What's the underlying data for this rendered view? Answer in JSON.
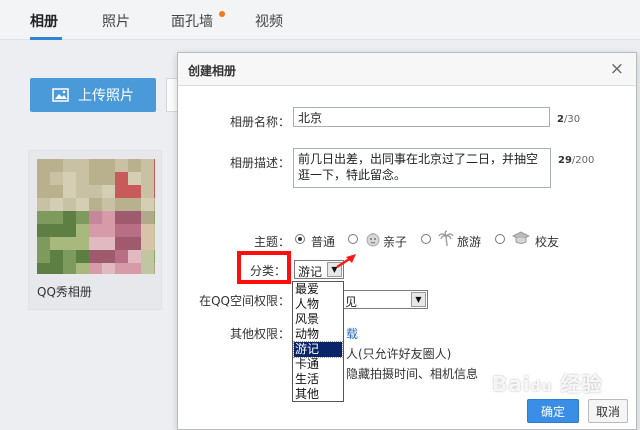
{
  "tabs": [
    {
      "label": "相册"
    },
    {
      "label": "照片"
    },
    {
      "label": "面孔墙"
    },
    {
      "label": "视频"
    }
  ],
  "upload_button": {
    "label": "上传照片",
    "icon": "image-upload-icon"
  },
  "album": {
    "title": "QQ秀相册"
  },
  "dialog": {
    "title": "创建相册",
    "close_symbol": "×",
    "name_label": "相册名称：",
    "name_value": "北京",
    "name_count": "2",
    "name_max": "/30",
    "desc_label": "相册描述：",
    "desc_value": "前几日出差，出同事在北京过了二日，并抽空逛一下，特此留念。",
    "desc_count": "29",
    "desc_max": "/200",
    "theme_label": "主题：",
    "themes": [
      {
        "label": "普通",
        "checked": true
      },
      {
        "label": "亲子",
        "checked": false
      },
      {
        "label": "旅游",
        "checked": false
      },
      {
        "label": "校友",
        "checked": false
      }
    ],
    "category_label": "分类：",
    "category_value": "游记",
    "category_options": [
      "最爱",
      "人物",
      "风景",
      "动物",
      "游记",
      "卡通",
      "生活",
      "其他"
    ],
    "category_selected_index": 4,
    "permission_label": "在QQ空间权限：",
    "permission_value_partial": "见",
    "other_label": "其他权限：",
    "other_link_partial": "载",
    "other_note1_partial": "人(只允许好友圈人)",
    "other_note2_partial": "隐藏拍摄时间、相机信息",
    "ok_label": "确定",
    "cancel_label": "取消"
  },
  "watermark": "Bai 经验",
  "colors": {
    "accent": "#2f86d6",
    "highlight": "#ff0e0e",
    "selected": "#0a246a",
    "ok_button": "#3a8ee6"
  }
}
